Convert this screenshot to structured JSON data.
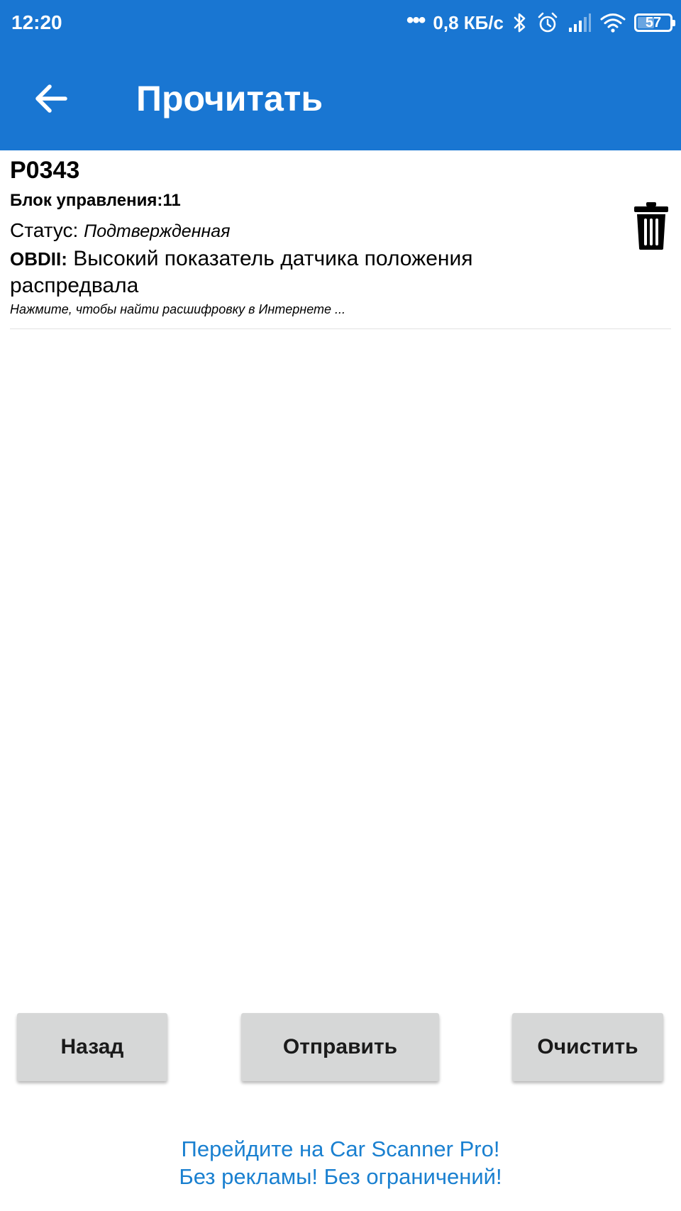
{
  "status_bar": {
    "time": "12:20",
    "dots": "•••",
    "net_speed": "0,8 КБ/с",
    "icons": [
      "bluetooth-icon",
      "alarm-icon",
      "signal-icon",
      "wifi-icon",
      "battery-icon"
    ],
    "battery_level": "57",
    "battery_fraction": 0.57,
    "color": "#1976d2"
  },
  "app_bar": {
    "title": "Прочитать",
    "back_icon": "arrow-left-icon"
  },
  "dtc": {
    "code": "P0343",
    "block": "Блок управления:11",
    "status_label": "Статус:",
    "status_value": "Подтвержденная",
    "desc_prefix": "OBDII:",
    "description": "Высокий показатель датчика положения распредвала",
    "hint": "Нажмите, чтобы найти расшифровку в Интернете ...",
    "delete_icon": "trash-icon"
  },
  "buttons": {
    "back": "Назад",
    "send": "Отправить",
    "clear": "Очистить"
  },
  "promo": {
    "line1": "Перейдите на Car Scanner Pro!",
    "line2": "Без рекламы! Без ограничений!",
    "color": "#1a80d0"
  }
}
